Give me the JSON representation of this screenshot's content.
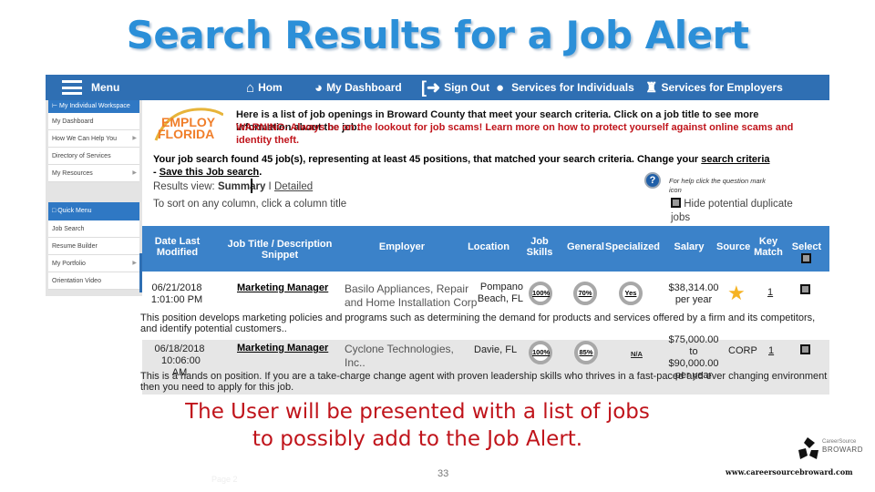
{
  "slide": {
    "title": "Search Results for a Job Alert",
    "caption_line1": "The User will be presented with a list of jobs",
    "caption_line2": "to possibly add to the Job Alert.",
    "page_number": "33",
    "faint_label": "Page 2",
    "footer_url": "www.careersourcebroward.com",
    "footer_logo_small": "CareerSource",
    "footer_logo_big": "BROWARD",
    "colors": {
      "title": "#2b8fd8",
      "caption": "#c0141b",
      "nav": "#2f6fb3",
      "table_header": "#3b82c9"
    }
  },
  "topnav": {
    "menu": "Menu",
    "home": "Hom",
    "dashboard": "My Dashboard",
    "sign_out": "Sign Out",
    "individuals": "Services for Individuals",
    "employers": "Services for Employers"
  },
  "sidebar": {
    "workspace_header": "My Individual Workspace",
    "workspace_items": [
      {
        "label": "My Dashboard",
        "submenu": false
      },
      {
        "label": "How We Can Help You",
        "submenu": true
      },
      {
        "label": "Directory of Services",
        "submenu": false
      },
      {
        "label": "My Resources",
        "submenu": true
      }
    ],
    "quick_header": "Quick Menu",
    "quick_items": [
      {
        "label": "Job Search",
        "submenu": false
      },
      {
        "label": "Resume Builder",
        "submenu": false
      },
      {
        "label": "My Portfolio",
        "submenu": true
      },
      {
        "label": "Orientation Video",
        "submenu": false
      }
    ]
  },
  "logo": {
    "line1": "EMPLOY",
    "line2": "FLORIDA"
  },
  "intro": {
    "text": "Here is a list of job openings in Broward County that meet your search criteria.  Click on a job title to see more information about the job.",
    "warning": "WARNING: Always be on the lookout for job scams! Learn more on how to protect yourself against online scams and identity theft."
  },
  "results": {
    "found_text": "Your job search found 45 job(s), representing at least 45 positions, that matched your search criteria. Change your ",
    "search_criteria_link": "search criteria",
    "separator": " - ",
    "save_link": "Save this Job search",
    "view_label": "Results view: ",
    "view_summary": "Summary",
    "view_sep": " I ",
    "view_detailed": "Detailed",
    "sort_hint": "To sort on any column, click a column title",
    "help_text": "For help click the question mark icon",
    "hide_duplicates": "Hide potential duplicate jobs"
  },
  "table": {
    "columns": [
      "Date Last Modified",
      "Job Title / Description Snippet",
      "Employer",
      "Location",
      "Job Skills",
      "General",
      "Specialized",
      "Salary",
      "Source",
      "Key Match",
      "Select"
    ],
    "rows": [
      {
        "date": "06/21/2018",
        "time": "1:01:00 PM",
        "title": "Marketing Manager",
        "employer": "Basilo Appliances, Repair and Home Installation Corp",
        "location": "Pompano Beach, FL",
        "job_skills": "100%",
        "general": "70%",
        "specialized": "Yes",
        "salary": "$38,314.00 per year",
        "source": "star",
        "key_match": "1",
        "selected": false,
        "snippet": "This position develops marketing policies and programs such as determining the demand for products and services offered by a firm and its competitors, and identify potential customers.."
      },
      {
        "date": "06/18/2018",
        "time": "10:06:00 AM",
        "title": "Marketing Manager",
        "employer": "Cyclone Technologies, Inc..",
        "location": "Davie, FL",
        "job_skills": "100%",
        "general": "85%",
        "specialized": "N/A",
        "salary": "$75,000.00 to $90,000.00 per year",
        "source": "CORP",
        "key_match": "1",
        "selected": false,
        "snippet": "This is a hands on position. If you are a take-charge change agent with proven leadership skills who thrives in a fast-paced and ever changing environment then you need to apply for this job."
      }
    ]
  }
}
